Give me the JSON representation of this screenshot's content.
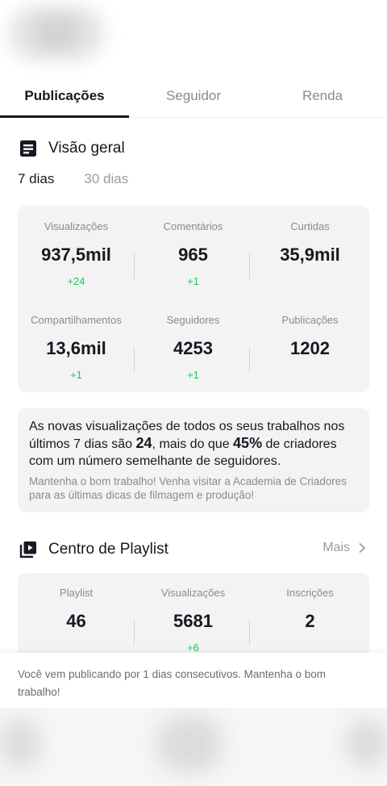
{
  "tabs": [
    {
      "label": "Publicações",
      "active": true
    },
    {
      "label": "Seguidor",
      "active": false
    },
    {
      "label": "Renda",
      "active": false
    }
  ],
  "overview": {
    "title": "Visão geral",
    "icon": "document-icon",
    "periods": [
      {
        "label": "7 dias",
        "active": true
      },
      {
        "label": "30 dias",
        "active": false
      }
    ],
    "stats": [
      {
        "label": "Visualizações",
        "value": "937,5mil",
        "delta": "+24"
      },
      {
        "label": "Comentários",
        "value": "965",
        "delta": "+1"
      },
      {
        "label": "Curtidas",
        "value": "35,9mil",
        "delta": ""
      },
      {
        "label": "Compartilhamentos",
        "value": "13,6mil",
        "delta": "+1"
      },
      {
        "label": "Seguidores",
        "value": "4253",
        "delta": "+1"
      },
      {
        "label": "Publicações",
        "value": "1202",
        "delta": ""
      }
    ]
  },
  "summary": {
    "text_1": "As novas visualizações de todos os seus trabalhos nos últimos 7 dias são ",
    "count": "24",
    "text_2": ", mais do que ",
    "percent": "45%",
    "text_3": " de criadores com um número semelhante de seguidores.",
    "tip": "Mantenha o bom trabalho! Venha visitar a Academia de Criadores para as últimas dicas de filmagem e produção!"
  },
  "playlist": {
    "title": "Centro de Playlist",
    "icon": "playlist-icon",
    "more_label": "Mais",
    "stats": [
      {
        "label": "Playlist",
        "value": "46",
        "delta": ""
      },
      {
        "label": "Visualizações",
        "value": "5681",
        "delta": "+6"
      },
      {
        "label": "Inscrições",
        "value": "2",
        "delta": ""
      }
    ]
  },
  "toast": {
    "text": "Você vem publicando por 1 dias consecutivos. Mantenha o bom trabalho!"
  },
  "colors": {
    "accent_text": "#161823",
    "positive": "#20c45a",
    "muted": "#8a8b91",
    "card_bg": "#f3f3f3"
  }
}
